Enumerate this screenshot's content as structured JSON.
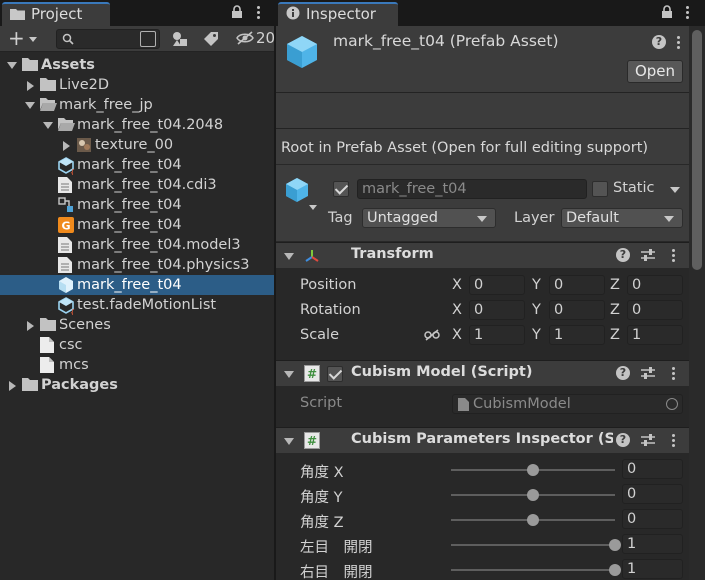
{
  "project_panel": {
    "tab_label": "Project",
    "toolbar": {
      "add_label": "+",
      "search_placeholder": "",
      "hidden_count": "20"
    },
    "tree": [
      {
        "label": "Assets",
        "icon": "folder-icon",
        "indent": 0,
        "expanded": true,
        "bold": true
      },
      {
        "label": "Live2D",
        "icon": "folder-icon",
        "indent": 1,
        "expanded": false
      },
      {
        "label": "mark_free_jp",
        "icon": "folder-open-icon",
        "indent": 1,
        "expanded": true
      },
      {
        "label": "mark_free_t04.2048",
        "icon": "folder-open-icon",
        "indent": 2,
        "expanded": true
      },
      {
        "label": "texture_00",
        "icon": "texture-icon",
        "indent": 3,
        "expanded": false
      },
      {
        "label": "mark_free_t04",
        "icon": "prefab-script-icon",
        "indent": 2
      },
      {
        "label": "mark_free_t04.cdi3",
        "icon": "text-file-icon",
        "indent": 2
      },
      {
        "label": "mark_free_t04",
        "icon": "model-icon",
        "indent": 2
      },
      {
        "label": "mark_free_t04",
        "icon": "orange-g-icon",
        "indent": 2
      },
      {
        "label": "mark_free_t04.model3",
        "icon": "text-file-icon",
        "indent": 2
      },
      {
        "label": "mark_free_t04.physics3",
        "icon": "text-file-icon",
        "indent": 2
      },
      {
        "label": "mark_free_t04",
        "icon": "prefab-icon",
        "indent": 2,
        "selected": true
      },
      {
        "label": "test.fadeMotionList",
        "icon": "prefab-script-icon",
        "indent": 2
      },
      {
        "label": "Scenes",
        "icon": "folder-icon",
        "indent": 1,
        "expanded": false
      },
      {
        "label": "csc",
        "icon": "blank-file-icon",
        "indent": 1
      },
      {
        "label": "mcs",
        "icon": "blank-file-icon",
        "indent": 1
      },
      {
        "label": "Packages",
        "icon": "folder-icon",
        "indent": 0,
        "expanded": false,
        "bold": true
      }
    ]
  },
  "inspector": {
    "tab_label": "Inspector",
    "header": {
      "title": "mark_free_t04 (Prefab Asset)",
      "open_button": "Open",
      "note": "Root in Prefab Asset (Open for full editing support)"
    },
    "object": {
      "active": true,
      "name": "mark_free_t04",
      "static_label": "Static",
      "tag_label": "Tag",
      "tag_value": "Untagged",
      "layer_label": "Layer",
      "layer_value": "Default"
    },
    "transform": {
      "title": "Transform",
      "rows": [
        {
          "label": "Position",
          "x": "0",
          "y": "0",
          "z": "0"
        },
        {
          "label": "Rotation",
          "x": "0",
          "y": "0",
          "z": "0"
        },
        {
          "label": "Scale",
          "x": "1",
          "y": "1",
          "z": "1"
        }
      ],
      "axis_x": "X",
      "axis_y": "Y",
      "axis_z": "Z"
    },
    "cubism_model": {
      "title": "Cubism Model (Script)",
      "enabled": true,
      "script_label": "Script",
      "script_value": "CubismModel"
    },
    "cubism_parameters": {
      "title": "Cubism Parameters Inspector (Scr",
      "params": [
        {
          "label": "角度 X",
          "value": "0",
          "fraction": 0.5
        },
        {
          "label": "角度 Y",
          "value": "0",
          "fraction": 0.5
        },
        {
          "label": "角度 Z",
          "value": "0",
          "fraction": 0.5
        },
        {
          "label": "左目　開閉",
          "value": "1",
          "fraction": 1.0
        },
        {
          "label": "右目　開閉",
          "value": "1",
          "fraction": 1.0
        }
      ]
    }
  }
}
